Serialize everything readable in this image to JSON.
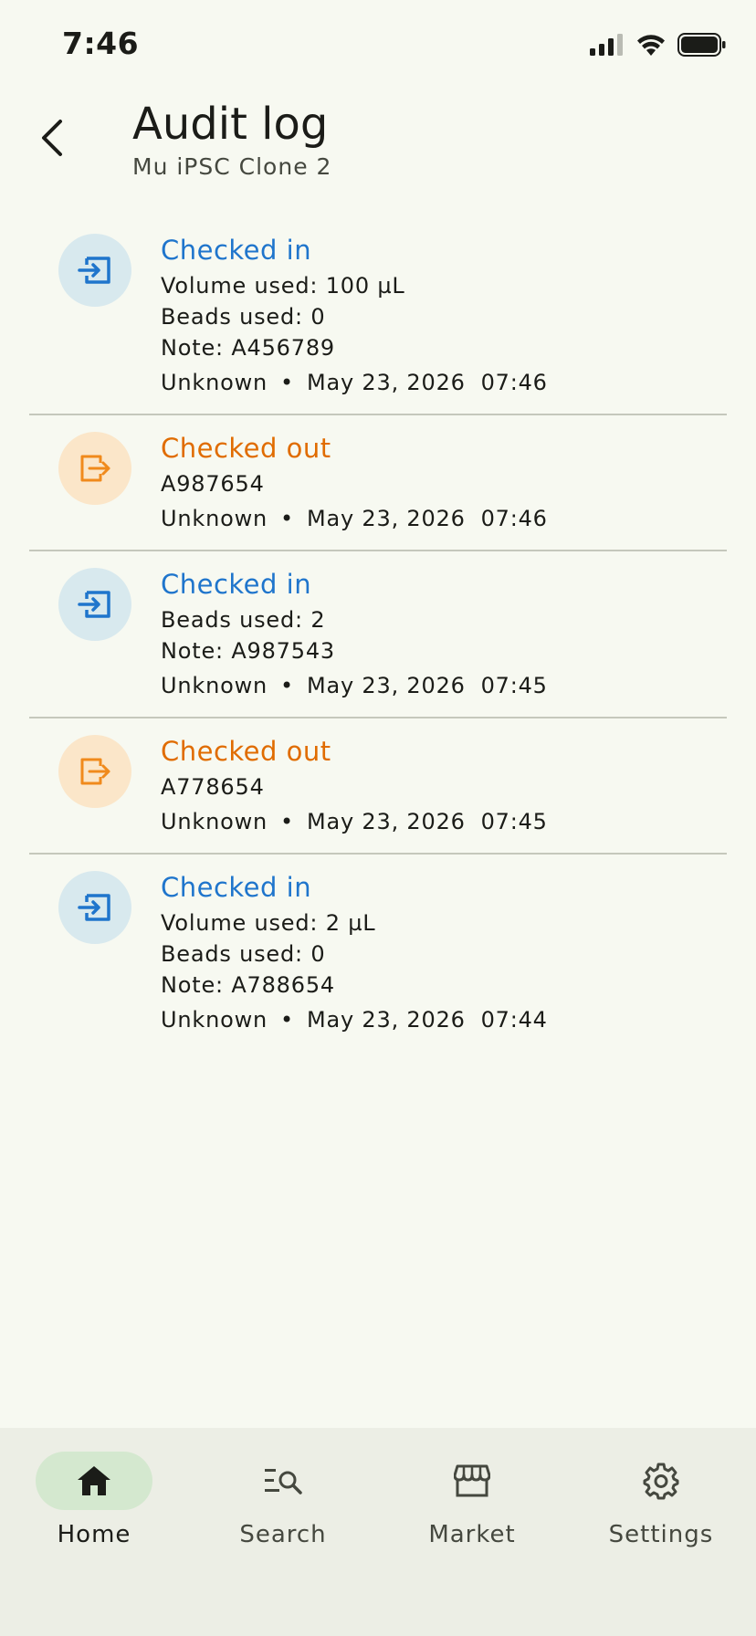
{
  "status_bar": {
    "time": "7:46"
  },
  "header": {
    "title": "Audit log",
    "subtitle": "Mu iPSC Clone 2"
  },
  "entries": [
    {
      "type": "in",
      "title": "Checked in",
      "details": [
        "Volume used: 100 µL",
        "Beads used: 0",
        "Note: A456789"
      ],
      "user": "Unknown",
      "separator": "•",
      "timestamp": "May 23, 2026  07:46"
    },
    {
      "type": "out",
      "title": "Checked out",
      "details": [
        "A987654"
      ],
      "user": "Unknown",
      "separator": "•",
      "timestamp": "May 23, 2026  07:46"
    },
    {
      "type": "in",
      "title": "Checked in",
      "details": [
        "Beads used: 2",
        "Note: A987543"
      ],
      "user": "Unknown",
      "separator": "•",
      "timestamp": "May 23, 2026  07:45"
    },
    {
      "type": "out",
      "title": "Checked out",
      "details": [
        "A778654"
      ],
      "user": "Unknown",
      "separator": "•",
      "timestamp": "May 23, 2026  07:45"
    },
    {
      "type": "in",
      "title": "Checked in",
      "details": [
        "Volume used: 2 µL",
        "Beads used: 0",
        "Note: A788654"
      ],
      "user": "Unknown",
      "separator": "•",
      "timestamp": "May 23, 2026  07:44"
    }
  ],
  "bottom_nav": {
    "items": [
      {
        "label": "Home",
        "icon": "home-icon",
        "active": true
      },
      {
        "label": "Search",
        "icon": "search-list-icon",
        "active": false
      },
      {
        "label": "Market",
        "icon": "storefront-icon",
        "active": false
      },
      {
        "label": "Settings",
        "icon": "gear-icon",
        "active": false
      }
    ]
  },
  "colors": {
    "checked_in": "#1f75cc",
    "checked_out": "#e06c00",
    "active_nav": "#d4e8cf"
  }
}
